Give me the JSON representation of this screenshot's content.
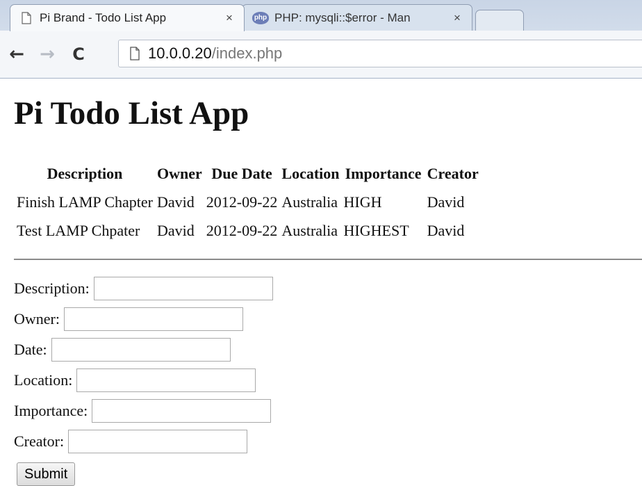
{
  "browser": {
    "tabs": [
      {
        "title": "Pi Brand - Todo List App",
        "close": "×",
        "icon": "page-icon",
        "active": true
      },
      {
        "title": "PHP: mysqli::$error - Man",
        "close": "×",
        "icon": "php-icon",
        "icon_text": "php",
        "active": false
      }
    ],
    "nav": {
      "back": "←",
      "forward": "→",
      "reload": "C"
    },
    "url": {
      "host": "10.0.0.20",
      "path": "/index.php"
    }
  },
  "page": {
    "title": "Pi Todo List App",
    "table": {
      "headers": [
        "Description",
        "Owner",
        "Due Date",
        "Location",
        "Importance",
        "Creator"
      ],
      "rows": [
        [
          "Finish LAMP Chapter",
          "David",
          "2012-09-22",
          "Australia",
          "HIGH",
          "David"
        ],
        [
          "Test LAMP Chpater",
          "David",
          "2012-09-22",
          "Australia",
          "HIGHEST",
          "David"
        ]
      ]
    },
    "form": {
      "fields": [
        {
          "label": "Description:",
          "value": ""
        },
        {
          "label": "Owner:",
          "value": ""
        },
        {
          "label": "Date:",
          "value": ""
        },
        {
          "label": "Location:",
          "value": ""
        },
        {
          "label": "Importance:",
          "value": ""
        },
        {
          "label": "Creator:",
          "value": ""
        }
      ],
      "submit_label": "Submit"
    }
  }
}
